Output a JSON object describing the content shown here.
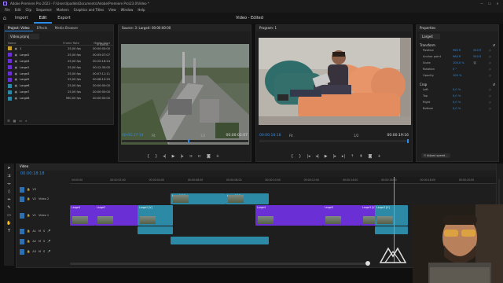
{
  "app": {
    "title": "Adobe Premiere Pro 2023 - F:\\Users\\Ipadde\\Documents\\Adobe\\Premiere Pro\\23.0\\Video *"
  },
  "menu": [
    "File",
    "Edit",
    "Clip",
    "Sequence",
    "Markers",
    "Graphics and Titles",
    "View",
    "Window",
    "Help"
  ],
  "workspace": {
    "tabs": [
      "Import",
      "Edit",
      "Export"
    ],
    "active": "Edit",
    "center_title": "Video - Edited"
  },
  "project": {
    "tabs": [
      "Project: Video",
      "Effects",
      "Media Browser"
    ],
    "bin": "Video.prproj",
    "item_count": "9 items",
    "columns": {
      "name": "Name",
      "frame_rate": "Frame Rate",
      "media_start": "Media Start"
    },
    "items": [
      {
        "name": "1",
        "frame_rate": "25,00 fps",
        "start": "00:00:00:00",
        "color": "#c9a227"
      },
      {
        "name": "Large2",
        "frame_rate": "25,00 fps",
        "start": "00:05:07:07",
        "color": "#6b2fd6"
      },
      {
        "name": "Large4",
        "frame_rate": "25,00 fps",
        "start": "00:20:16:24",
        "color": "#6b2fd6"
      },
      {
        "name": "Large1",
        "frame_rate": "25,00 fps",
        "start": "00:12:30:00",
        "color": "#6b2fd6"
      },
      {
        "name": "Large3",
        "frame_rate": "25,00 fps",
        "start": "00:07:11:11",
        "color": "#6b2fd6"
      },
      {
        "name": "Large5",
        "frame_rate": "25,00 fps",
        "start": "00:08:15:20",
        "color": "#6b2fd6"
      },
      {
        "name": "Large6",
        "frame_rate": "25,00 fps",
        "start": "00:00:00:00",
        "color": "#2c8aa6"
      },
      {
        "name": "Large7",
        "frame_rate": "25,00 fps",
        "start": "00:00:00:00",
        "color": "#2c8aa6"
      },
      {
        "name": "Large8",
        "frame_rate": "960,00 fps",
        "start": "00:00:00:00",
        "color": "#2c8aa6"
      }
    ]
  },
  "source": {
    "title": "Source: 3: Large4: 00:00:00:00",
    "tc_left": "00:05:37:14",
    "fit": "Fit",
    "ratio": "1/2",
    "tc_right": "00:00:02:07"
  },
  "program": {
    "title": "Program: 1",
    "tc_left": "00:00:18:18",
    "fit": "Fit",
    "ratio": "1/2",
    "tc_right": "00:00:19:16"
  },
  "properties": {
    "title": "Properties",
    "clip": "Large4",
    "transform": {
      "label": "Transform",
      "position_label": "Position",
      "position_x": "960 fl",
      "position_y": "540 fl",
      "anchor_label": "Anchor point",
      "anchor_x": "960 fl",
      "anchor_y": "540 fl",
      "scale_label": "Scale",
      "scale": "100,0 %",
      "rotation_label": "Rotation",
      "rotation": "0 °",
      "opacity_label": "Opacity",
      "opacity": "100 %"
    },
    "crop": {
      "label": "Crop",
      "left_label": "Left",
      "left": "0,0 %",
      "top_label": "Top",
      "top": "0,0 %",
      "right_label": "Right",
      "right": "0,0 %",
      "bottom_label": "Bottom",
      "bottom": "0,0 %"
    },
    "adjust_label": "Adjust speed..."
  },
  "timeline": {
    "sequence": "Video",
    "timecode": "00:00:18:18",
    "ruler": [
      "00:00:00",
      "00:00:02:00",
      "00:00:04:00",
      "00:00:06:00",
      "00:00:08:00",
      "00:00:10:00",
      "00:00:12:00",
      "00:00:14:00",
      "00:00:16:00",
      "00:00:18:00",
      "00:00:20:00"
    ],
    "tracks": {
      "v3": "V3",
      "v2": "V2",
      "v1": "V1",
      "v1_name": "Video 1",
      "v2_name": "Video 2",
      "a1": "A1",
      "a2": "A2",
      "a3": "A3",
      "m": "M",
      "s": "S"
    },
    "clips": {
      "v2_a": "Large1 [V]",
      "v2_b": "Large4 [V]",
      "v2_c": "Large4 [V]",
      "v1_a": "Large4",
      "v1_b": "Large2",
      "v1_c": "Large1 [V]",
      "v1_d": "Large4",
      "v1_e": "Large5",
      "v1_f": "Large3 [V]",
      "v1_g": "Large3 [V]"
    }
  },
  "colors": {
    "accent": "#2d8ceb",
    "video": "#6b2fd6",
    "audio": "#2c8aa6"
  }
}
